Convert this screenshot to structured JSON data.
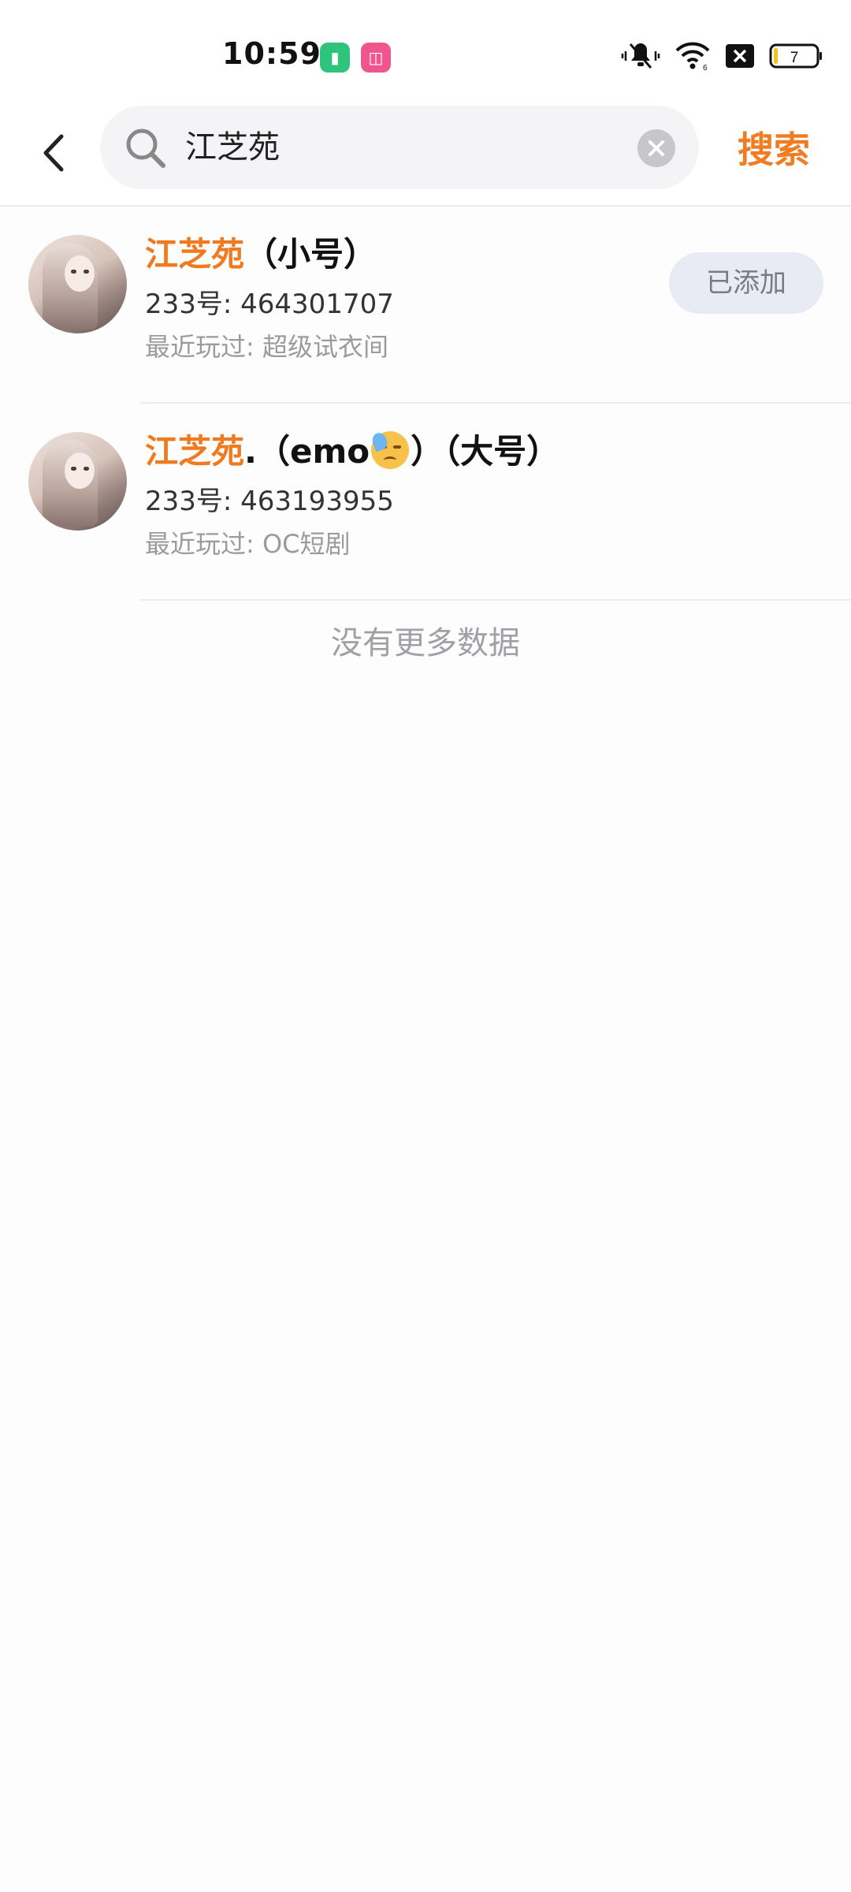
{
  "status_bar": {
    "time": "10:59",
    "battery_level": "7",
    "icons": [
      "battery-saver-app-icon",
      "bilibili-app-icon",
      "vibrate-mute-icon",
      "wifi-icon",
      "sim-blocked-icon",
      "battery-icon"
    ]
  },
  "search": {
    "query": "江芝苑",
    "button_label": "搜索"
  },
  "results": [
    {
      "name_highlight": "江芝苑",
      "name_suffix": "（小号）",
      "id_text": "233号: 464301707",
      "recent_text": "最近玩过: 超级试衣间",
      "action_label": "已添加"
    },
    {
      "name_highlight": "江芝苑",
      "name_suffix_1": ".（emo",
      "name_emoji": "downcast-sweat-face-emoji",
      "name_suffix_2": "）（大号）",
      "id_text": "233号: 463193955",
      "recent_text": "最近玩过: OC短剧"
    }
  ],
  "footer": {
    "no_more": "没有更多数据"
  },
  "colors": {
    "accent": "#ef7a1f",
    "added_button_bg": "#e8ebf3"
  }
}
